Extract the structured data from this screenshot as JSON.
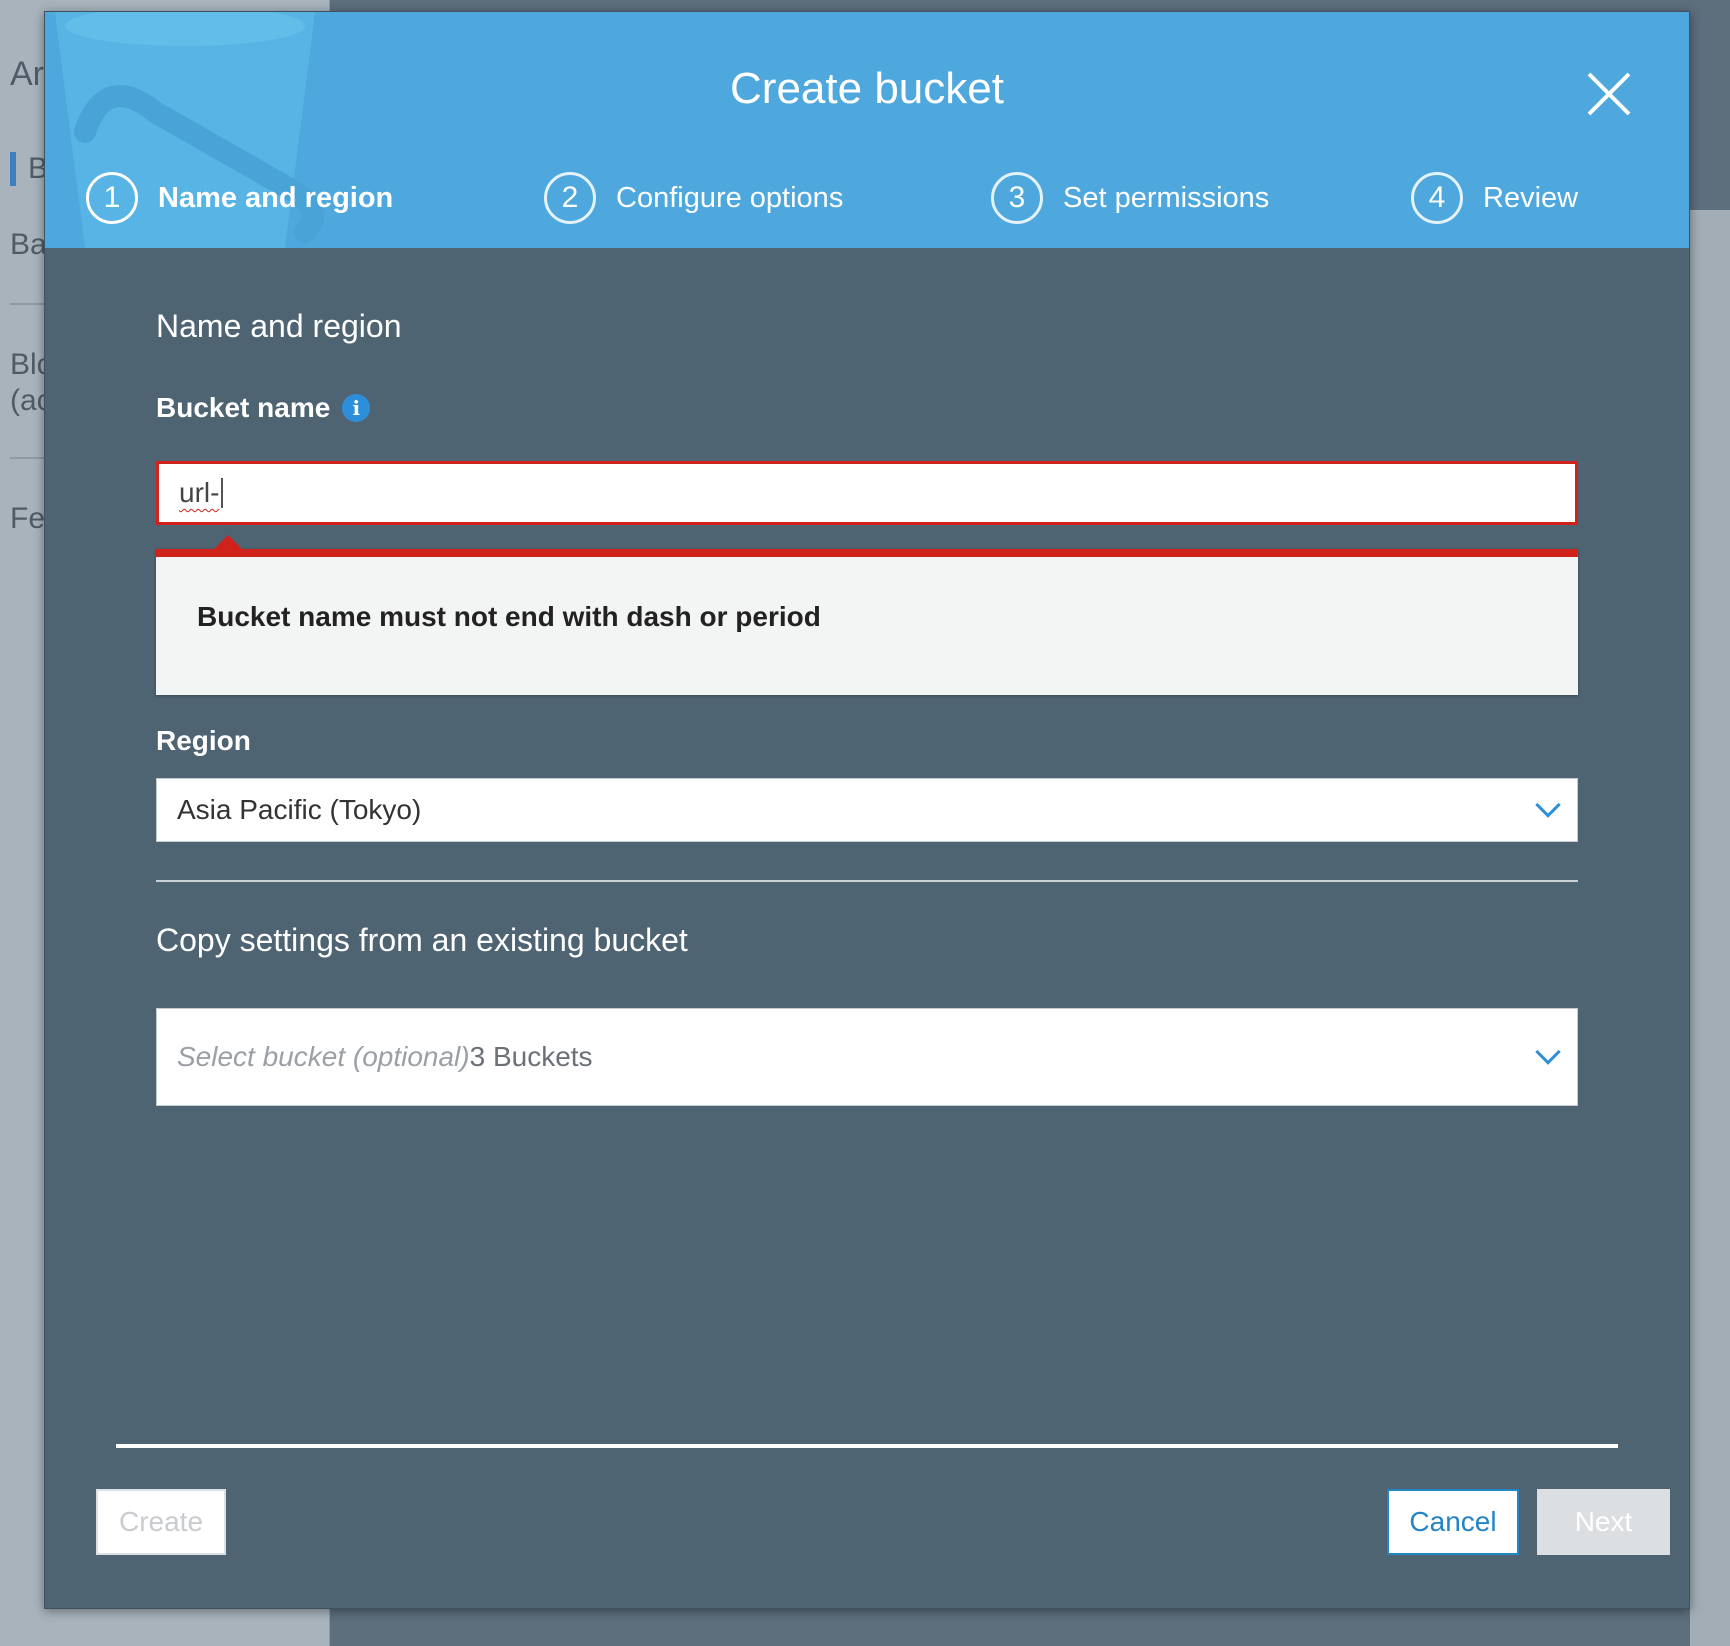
{
  "background": {
    "fragments": [
      "Ar",
      "B",
      "Ba",
      "Blc",
      "(ac",
      "Fe"
    ]
  },
  "modal": {
    "title": "Create bucket",
    "steps": [
      {
        "number": "1",
        "label": "Name and region",
        "active": true
      },
      {
        "number": "2",
        "label": "Configure options",
        "active": false
      },
      {
        "number": "3",
        "label": "Set permissions",
        "active": false
      },
      {
        "number": "4",
        "label": "Review",
        "active": false
      }
    ],
    "section_title": "Name and region",
    "bucket_name": {
      "label": "Bucket name",
      "value": "url-",
      "error": "Bucket name must not end with dash or period"
    },
    "region": {
      "label": "Region",
      "selected": "Asia Pacific (Tokyo)"
    },
    "copy_settings": {
      "title": "Copy settings from an existing bucket",
      "placeholder": "Select bucket (optional)",
      "count": "3 Buckets"
    },
    "buttons": {
      "create": "Create",
      "cancel": "Cancel",
      "next": "Next"
    }
  },
  "colors": {
    "header_blue": "#4ea8dd",
    "body_slate": "#4e6473",
    "error_red": "#d0211b",
    "link_blue": "#2384c6"
  }
}
